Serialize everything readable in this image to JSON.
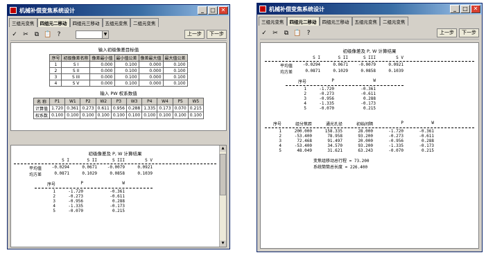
{
  "left": {
    "title": "机械补偿变焦系统设计",
    "tabs": [
      "三组元变焦",
      "四组元二移动",
      "四组元三移动",
      "五组元变焦",
      "二组元变焦"
    ],
    "active_tab": 1,
    "prev_label": "上一步",
    "next_label": "下一步",
    "table1_title": "输入初级像差目标值",
    "table1_headers": [
      "序号",
      "初级像差名称",
      "像差最小值",
      "最小值公差",
      "像差最大值",
      "最大值公差"
    ],
    "table1_rows": [
      [
        "1",
        "S I",
        "0.000",
        "0.100",
        "0.000",
        "0.100"
      ],
      [
        "2",
        "S II",
        "0.000",
        "0.100",
        "0.000",
        "0.100"
      ],
      [
        "3",
        "S III",
        "0.000",
        "0.100",
        "0.000",
        "0.100"
      ],
      [
        "4",
        "S V",
        "0.000",
        "0.100",
        "0.000",
        "0.100"
      ]
    ],
    "table2_title": "输入 PW 权系数值",
    "table2_headers": [
      "名 称",
      "P1",
      "W1",
      "P2",
      "W2",
      "P3",
      "W3",
      "P4",
      "W4",
      "P5",
      "W5"
    ],
    "table2_rows": [
      [
        "计算值",
        "1.720",
        "0.361",
        "0.273",
        "0.611",
        "0.956",
        "0.288",
        "1.335",
        "0.173",
        "0.070",
        "0.215"
      ],
      [
        "权系数",
        "0.100",
        "0.100",
        "0.100",
        "0.100",
        "0.100",
        "0.100",
        "0.100",
        "0.100",
        "0.100",
        "0.100"
      ]
    ]
  },
  "results": {
    "title": "初级像差及 P, W 计算结果",
    "aberr_headers": [
      "S I",
      "S II",
      "S III",
      "S V"
    ],
    "mean_label": "平均值",
    "mean": [
      "-0.0294",
      "0.0671",
      "-0.0079",
      "0.0921"
    ],
    "var_label": "均方差",
    "var": [
      "0.0871",
      "0.1029",
      "0.0858",
      "0.1039"
    ],
    "pw_headers": [
      "序号",
      "P",
      "W"
    ],
    "pw_rows": [
      [
        "1",
        "-1.720",
        "-0.361"
      ],
      [
        "2",
        "-0.273",
        "-0.611"
      ],
      [
        "3",
        "-0.956",
        "0.288"
      ],
      [
        "4",
        "-1.335",
        "-0.173"
      ],
      [
        "5",
        "-0.070",
        "0.215"
      ]
    ],
    "group_headers": [
      "序号",
      "组分焦距",
      "通光孔径",
      "初始间隔",
      "P",
      "W"
    ],
    "group_rows": [
      [
        "1",
        "200.000",
        "158.335",
        "28.000",
        "-1.720",
        "-0.361"
      ],
      [
        "2",
        "-53.400",
        "78.958",
        "93.200",
        "-0.273",
        "-0.611"
      ],
      [
        "3",
        "72.468",
        "91.497",
        "20.000",
        "-0.956",
        "0.288"
      ],
      [
        "4",
        "-53.400",
        "34.570",
        "93.200",
        "-1.335",
        "-0.173"
      ],
      [
        "5",
        "48.049",
        "31.621",
        "63.243",
        "-0.070",
        "0.215"
      ]
    ],
    "stroke_label": "变焦组移动总行程 = 73.200",
    "length_label": "系统筒筒总长度 = 226.400"
  },
  "right": {
    "title": "机械补偿变焦系统设计",
    "tabs": [
      "三组元变焦",
      "四组元二移动",
      "四组元三移动",
      "五组元变焦",
      "二组元变焦"
    ],
    "active_tab": 1,
    "prev_label": "上一步",
    "next_label": "下一步"
  }
}
